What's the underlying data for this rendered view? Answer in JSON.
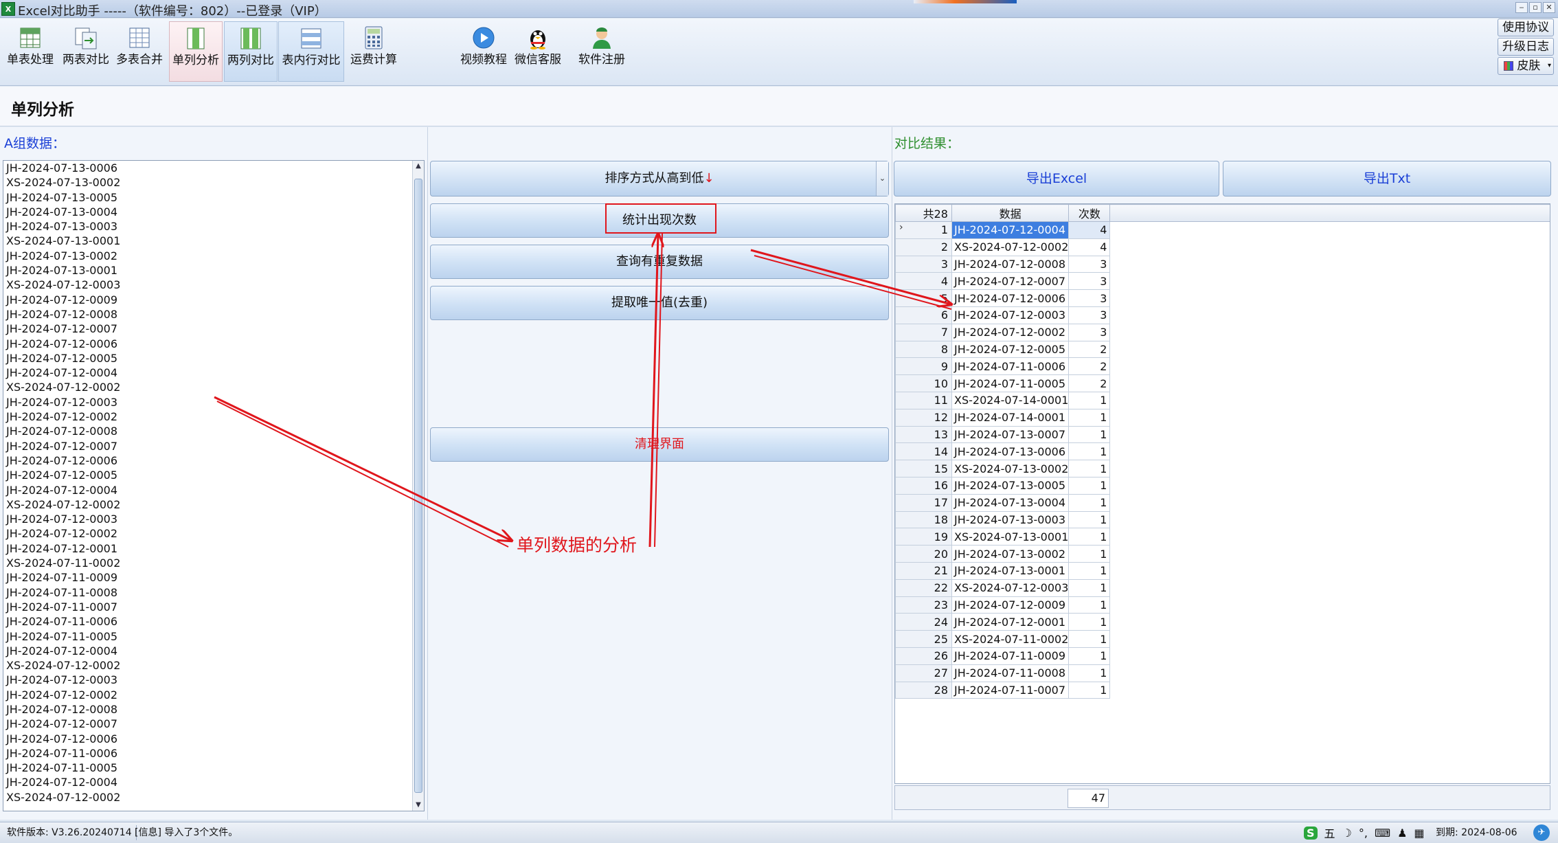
{
  "window": {
    "title": "Excel对比助手 -----（软件编号：802）--已登录（VIP）",
    "app_icon": "excel-icon",
    "min": "‒",
    "max": "▫",
    "close": "✕"
  },
  "toolbar": {
    "items": [
      {
        "label": "单表处理",
        "icon": "single-sheet-icon"
      },
      {
        "label": "两表对比",
        "icon": "two-sheets-icon"
      },
      {
        "label": "多表合并",
        "icon": "multi-sheet-icon"
      },
      {
        "label": "单列分析",
        "icon": "single-column-icon"
      },
      {
        "label": "两列对比",
        "icon": "two-columns-icon"
      },
      {
        "label": "表内行对比",
        "icon": "row-compare-icon"
      },
      {
        "label": "运费计算",
        "icon": "calculator-icon"
      },
      {
        "label": "视频教程",
        "icon": "play-icon"
      },
      {
        "label": "微信客服",
        "icon": "qq-penguin-icon"
      },
      {
        "label": "软件注册",
        "icon": "user-register-icon"
      }
    ],
    "right": {
      "agreement": "使用协议",
      "changelog": "升级日志",
      "skin": "皮肤"
    }
  },
  "page": {
    "title": "单列分析"
  },
  "left": {
    "label": "A组数据：",
    "items": [
      "JH-2024-07-13-0006",
      "XS-2024-07-13-0002",
      "JH-2024-07-13-0005",
      "JH-2024-07-13-0004",
      "JH-2024-07-13-0003",
      "XS-2024-07-13-0001",
      "JH-2024-07-13-0002",
      "JH-2024-07-13-0001",
      "XS-2024-07-12-0003",
      "JH-2024-07-12-0009",
      "JH-2024-07-12-0008",
      "JH-2024-07-12-0007",
      "JH-2024-07-12-0006",
      "JH-2024-07-12-0005",
      "JH-2024-07-12-0004",
      "XS-2024-07-12-0002",
      "JH-2024-07-12-0003",
      "JH-2024-07-12-0002",
      "JH-2024-07-12-0008",
      "JH-2024-07-12-0007",
      "JH-2024-07-12-0006",
      "JH-2024-07-12-0005",
      "JH-2024-07-12-0004",
      "XS-2024-07-12-0002",
      "JH-2024-07-12-0003",
      "JH-2024-07-12-0002",
      "JH-2024-07-12-0001",
      "XS-2024-07-11-0002",
      "JH-2024-07-11-0009",
      "JH-2024-07-11-0008",
      "JH-2024-07-11-0007",
      "JH-2024-07-11-0006",
      "JH-2024-07-11-0005",
      "JH-2024-07-12-0004",
      "XS-2024-07-12-0002",
      "JH-2024-07-12-0003",
      "JH-2024-07-12-0002",
      "JH-2024-07-12-0008",
      "JH-2024-07-12-0007",
      "JH-2024-07-12-0006",
      "JH-2024-07-11-0006",
      "JH-2024-07-11-0005",
      "JH-2024-07-12-0004",
      "XS-2024-07-12-0002"
    ]
  },
  "middle": {
    "sort_label": "排序方式从高到低",
    "sort_arrow": "↓",
    "count_button": "统计出现次数",
    "dup_button": "查询有重复数据",
    "unique_button": "提取唯一值(去重)",
    "clear_button": "清理界面"
  },
  "right": {
    "label": "对比结果：",
    "export_excel": "导出Excel",
    "export_txt": "导出Txt",
    "grid": {
      "header_count": "共28",
      "col_data": "数据",
      "col_times": "次数",
      "rows": [
        {
          "n": "1",
          "data": "JH-2024-07-12-0004",
          "times": "4"
        },
        {
          "n": "2",
          "data": "XS-2024-07-12-0002",
          "times": "4"
        },
        {
          "n": "3",
          "data": "JH-2024-07-12-0008",
          "times": "3"
        },
        {
          "n": "4",
          "data": "JH-2024-07-12-0007",
          "times": "3"
        },
        {
          "n": "5",
          "data": "JH-2024-07-12-0006",
          "times": "3"
        },
        {
          "n": "6",
          "data": "JH-2024-07-12-0003",
          "times": "3"
        },
        {
          "n": "7",
          "data": "JH-2024-07-12-0002",
          "times": "3"
        },
        {
          "n": "8",
          "data": "JH-2024-07-12-0005",
          "times": "2"
        },
        {
          "n": "9",
          "data": "JH-2024-07-11-0006",
          "times": "2"
        },
        {
          "n": "10",
          "data": "JH-2024-07-11-0005",
          "times": "2"
        },
        {
          "n": "11",
          "data": "XS-2024-07-14-0001",
          "times": "1"
        },
        {
          "n": "12",
          "data": "JH-2024-07-14-0001",
          "times": "1"
        },
        {
          "n": "13",
          "data": "JH-2024-07-13-0007",
          "times": "1"
        },
        {
          "n": "14",
          "data": "JH-2024-07-13-0006",
          "times": "1"
        },
        {
          "n": "15",
          "data": "XS-2024-07-13-0002",
          "times": "1"
        },
        {
          "n": "16",
          "data": "JH-2024-07-13-0005",
          "times": "1"
        },
        {
          "n": "17",
          "data": "JH-2024-07-13-0004",
          "times": "1"
        },
        {
          "n": "18",
          "data": "JH-2024-07-13-0003",
          "times": "1"
        },
        {
          "n": "19",
          "data": "XS-2024-07-13-0001",
          "times": "1"
        },
        {
          "n": "20",
          "data": "JH-2024-07-13-0002",
          "times": "1"
        },
        {
          "n": "21",
          "data": "JH-2024-07-13-0001",
          "times": "1"
        },
        {
          "n": "22",
          "data": "XS-2024-07-12-0003",
          "times": "1"
        },
        {
          "n": "23",
          "data": "JH-2024-07-12-0009",
          "times": "1"
        },
        {
          "n": "24",
          "data": "JH-2024-07-12-0001",
          "times": "1"
        },
        {
          "n": "25",
          "data": "XS-2024-07-11-0002",
          "times": "1"
        },
        {
          "n": "26",
          "data": "JH-2024-07-11-0009",
          "times": "1"
        },
        {
          "n": "27",
          "data": "JH-2024-07-11-0008",
          "times": "1"
        },
        {
          "n": "28",
          "data": "JH-2024-07-11-0007",
          "times": "1"
        }
      ],
      "total": "47"
    }
  },
  "annotation": {
    "text": "单列数据的分析",
    "color": "#e0161c"
  },
  "status": {
    "version": "软件版本: V3.26.20240714",
    "message": "[信息] 导入了3个文件。",
    "expire": "到期: 2024-08-06",
    "ime_logo": "S",
    "ime_mode": "五"
  },
  "colors": {
    "accent_blue": "#1a3fd6",
    "accent_green": "#2f8f2f",
    "highlight_red": "#e0161c",
    "selection": "#3d7ee0"
  }
}
